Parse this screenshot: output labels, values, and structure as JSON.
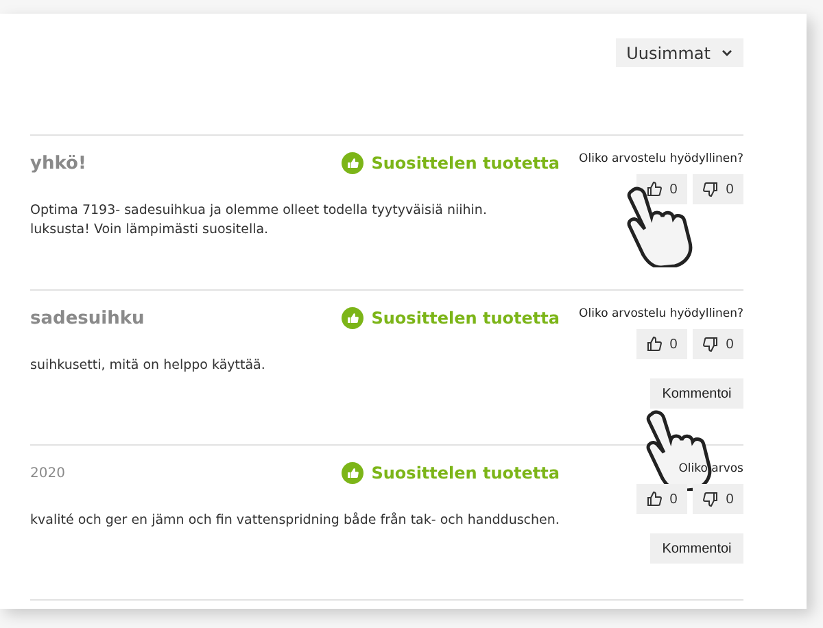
{
  "sort": {
    "label": "Uusimmat"
  },
  "reviews": [
    {
      "title": "yhkö!",
      "recommend": "Suosittelen tuotetta",
      "helpful_question": "Oliko arvostelu hyödyllinen?",
      "likes": "0",
      "dislikes": "0",
      "text_lines": [
        "Optima 7193- sadesuihkua ja olemme olleet todella tyytyväisiä niihin.",
        "luksusta! Voin lämpimästi suositella."
      ],
      "pointer_on_like": true,
      "pointer_on_comment": false
    },
    {
      "title": "sadesuihku",
      "recommend": "Suosittelen tuotetta",
      "helpful_question": "Oliko arvostelu hyödyllinen?",
      "likes": "0",
      "dislikes": "0",
      "text_lines": [
        "suihkusetti, mitä on helppo käyttää."
      ],
      "comment_button": "Kommentoi",
      "pointer_on_like": false,
      "pointer_on_comment": true
    },
    {
      "date": "2020",
      "recommend": "Suosittelen tuotetta",
      "helpful_question": "Oliko arvos",
      "likes": "0",
      "dislikes": "0",
      "text_lines": [
        "kvalité och ger en jämn och fin vattenspridning både från tak- och handduschen."
      ],
      "comment_button": "Kommentoi",
      "pointer_on_like": false,
      "pointer_on_comment": false
    }
  ]
}
